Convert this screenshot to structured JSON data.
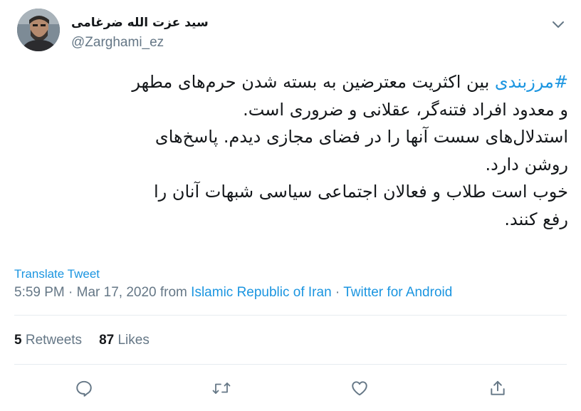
{
  "author": {
    "display_name": "سید عزت الله ضرغامی",
    "handle": "@Zarghami_ez"
  },
  "tweet": {
    "hashtag": "#مرزبندی",
    "line1_rest": " بین اکثریت معترضین به بسته شدن حرم‌های مطهر",
    "line2": "و معدود افراد فتنه‌گر، عقلانی و ضروری است.",
    "line3": "استدلال‌های سست آنها را در فضای مجازی دیدم. پاسخ‌های",
    "line4": "روشن دارد.",
    "line5": "خوب است طلاب و فعالان اجتماعی سیاسی شبهات آنان را",
    "line6": "رفع کنند."
  },
  "translate_label": "Translate Tweet",
  "meta": {
    "time_date": "5:59 PM · Mar 17, 2020 from ",
    "location": "Islamic Republic of Iran",
    "separator": " · ",
    "source": "Twitter for Android"
  },
  "stats": {
    "retweets_count": "5",
    "retweets_label": "Retweets",
    "likes_count": "87",
    "likes_label": "Likes"
  },
  "icons": {
    "reply": "reply-icon",
    "retweet": "retweet-icon",
    "like": "heart-icon",
    "share": "share-icon",
    "caret": "chevron-down-icon"
  },
  "colors": {
    "accent": "#1b95e0",
    "secondary_text": "#657786",
    "primary_text": "#14171a",
    "divider": "#e6ecf0"
  }
}
